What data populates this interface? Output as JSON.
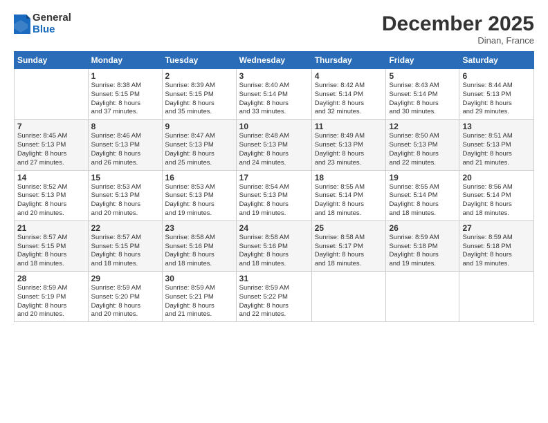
{
  "logo": {
    "general": "General",
    "blue": "Blue"
  },
  "title": "December 2025",
  "location": "Dinan, France",
  "weekdays": [
    "Sunday",
    "Monday",
    "Tuesday",
    "Wednesday",
    "Thursday",
    "Friday",
    "Saturday"
  ],
  "weeks": [
    [
      {
        "day": "",
        "info": ""
      },
      {
        "day": "1",
        "info": "Sunrise: 8:38 AM\nSunset: 5:15 PM\nDaylight: 8 hours\nand 37 minutes."
      },
      {
        "day": "2",
        "info": "Sunrise: 8:39 AM\nSunset: 5:15 PM\nDaylight: 8 hours\nand 35 minutes."
      },
      {
        "day": "3",
        "info": "Sunrise: 8:40 AM\nSunset: 5:14 PM\nDaylight: 8 hours\nand 33 minutes."
      },
      {
        "day": "4",
        "info": "Sunrise: 8:42 AM\nSunset: 5:14 PM\nDaylight: 8 hours\nand 32 minutes."
      },
      {
        "day": "5",
        "info": "Sunrise: 8:43 AM\nSunset: 5:14 PM\nDaylight: 8 hours\nand 30 minutes."
      },
      {
        "day": "6",
        "info": "Sunrise: 8:44 AM\nSunset: 5:13 PM\nDaylight: 8 hours\nand 29 minutes."
      }
    ],
    [
      {
        "day": "7",
        "info": "Sunrise: 8:45 AM\nSunset: 5:13 PM\nDaylight: 8 hours\nand 27 minutes."
      },
      {
        "day": "8",
        "info": "Sunrise: 8:46 AM\nSunset: 5:13 PM\nDaylight: 8 hours\nand 26 minutes."
      },
      {
        "day": "9",
        "info": "Sunrise: 8:47 AM\nSunset: 5:13 PM\nDaylight: 8 hours\nand 25 minutes."
      },
      {
        "day": "10",
        "info": "Sunrise: 8:48 AM\nSunset: 5:13 PM\nDaylight: 8 hours\nand 24 minutes."
      },
      {
        "day": "11",
        "info": "Sunrise: 8:49 AM\nSunset: 5:13 PM\nDaylight: 8 hours\nand 23 minutes."
      },
      {
        "day": "12",
        "info": "Sunrise: 8:50 AM\nSunset: 5:13 PM\nDaylight: 8 hours\nand 22 minutes."
      },
      {
        "day": "13",
        "info": "Sunrise: 8:51 AM\nSunset: 5:13 PM\nDaylight: 8 hours\nand 21 minutes."
      }
    ],
    [
      {
        "day": "14",
        "info": "Sunrise: 8:52 AM\nSunset: 5:13 PM\nDaylight: 8 hours\nand 20 minutes."
      },
      {
        "day": "15",
        "info": "Sunrise: 8:53 AM\nSunset: 5:13 PM\nDaylight: 8 hours\nand 20 minutes."
      },
      {
        "day": "16",
        "info": "Sunrise: 8:53 AM\nSunset: 5:13 PM\nDaylight: 8 hours\nand 19 minutes."
      },
      {
        "day": "17",
        "info": "Sunrise: 8:54 AM\nSunset: 5:13 PM\nDaylight: 8 hours\nand 19 minutes."
      },
      {
        "day": "18",
        "info": "Sunrise: 8:55 AM\nSunset: 5:14 PM\nDaylight: 8 hours\nand 18 minutes."
      },
      {
        "day": "19",
        "info": "Sunrise: 8:55 AM\nSunset: 5:14 PM\nDaylight: 8 hours\nand 18 minutes."
      },
      {
        "day": "20",
        "info": "Sunrise: 8:56 AM\nSunset: 5:14 PM\nDaylight: 8 hours\nand 18 minutes."
      }
    ],
    [
      {
        "day": "21",
        "info": "Sunrise: 8:57 AM\nSunset: 5:15 PM\nDaylight: 8 hours\nand 18 minutes."
      },
      {
        "day": "22",
        "info": "Sunrise: 8:57 AM\nSunset: 5:15 PM\nDaylight: 8 hours\nand 18 minutes."
      },
      {
        "day": "23",
        "info": "Sunrise: 8:58 AM\nSunset: 5:16 PM\nDaylight: 8 hours\nand 18 minutes."
      },
      {
        "day": "24",
        "info": "Sunrise: 8:58 AM\nSunset: 5:16 PM\nDaylight: 8 hours\nand 18 minutes."
      },
      {
        "day": "25",
        "info": "Sunrise: 8:58 AM\nSunset: 5:17 PM\nDaylight: 8 hours\nand 18 minutes."
      },
      {
        "day": "26",
        "info": "Sunrise: 8:59 AM\nSunset: 5:18 PM\nDaylight: 8 hours\nand 19 minutes."
      },
      {
        "day": "27",
        "info": "Sunrise: 8:59 AM\nSunset: 5:18 PM\nDaylight: 8 hours\nand 19 minutes."
      }
    ],
    [
      {
        "day": "28",
        "info": "Sunrise: 8:59 AM\nSunset: 5:19 PM\nDaylight: 8 hours\nand 20 minutes."
      },
      {
        "day": "29",
        "info": "Sunrise: 8:59 AM\nSunset: 5:20 PM\nDaylight: 8 hours\nand 20 minutes."
      },
      {
        "day": "30",
        "info": "Sunrise: 8:59 AM\nSunset: 5:21 PM\nDaylight: 8 hours\nand 21 minutes."
      },
      {
        "day": "31",
        "info": "Sunrise: 8:59 AM\nSunset: 5:22 PM\nDaylight: 8 hours\nand 22 minutes."
      },
      {
        "day": "",
        "info": ""
      },
      {
        "day": "",
        "info": ""
      },
      {
        "day": "",
        "info": ""
      }
    ]
  ]
}
